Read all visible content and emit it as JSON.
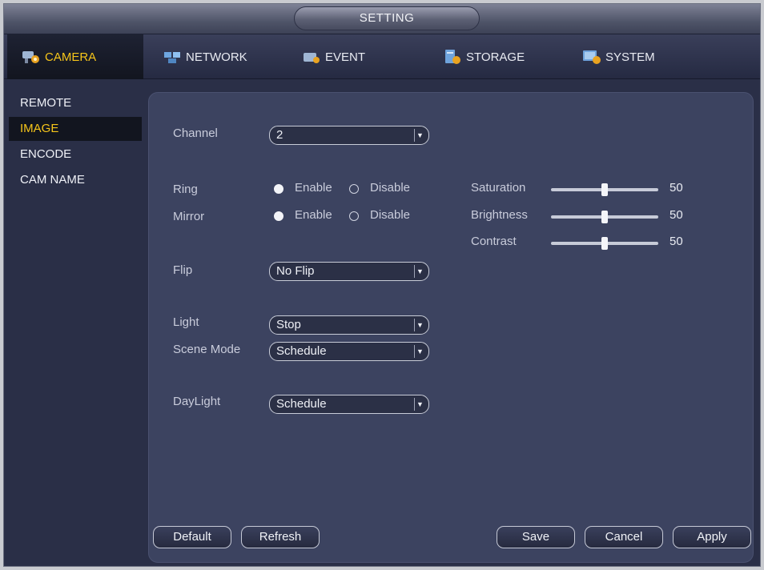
{
  "title": "SETTING",
  "tabs": [
    {
      "label": "CAMERA",
      "icon": "camera-icon",
      "active": true
    },
    {
      "label": "NETWORK",
      "icon": "network-icon"
    },
    {
      "label": "EVENT",
      "icon": "event-icon"
    },
    {
      "label": "STORAGE",
      "icon": "storage-icon"
    },
    {
      "label": "SYSTEM",
      "icon": "system-icon"
    }
  ],
  "sidebar": {
    "items": [
      {
        "label": "REMOTE"
      },
      {
        "label": "IMAGE",
        "active": true
      },
      {
        "label": "ENCODE"
      },
      {
        "label": "CAM NAME"
      }
    ]
  },
  "form": {
    "channel": {
      "label": "Channel",
      "value": "2"
    },
    "ring": {
      "label": "Ring",
      "enable": "Enable",
      "disable": "Disable",
      "selected": "Enable"
    },
    "mirror": {
      "label": "Mirror",
      "enable": "Enable",
      "disable": "Disable",
      "selected": "Enable"
    },
    "flip": {
      "label": "Flip",
      "value": "No Flip"
    },
    "light": {
      "label": "Light",
      "value": "Stop"
    },
    "scene_mode": {
      "label": "Scene Mode",
      "value": "Schedule"
    },
    "daylight": {
      "label": "DayLight",
      "value": "Schedule"
    }
  },
  "adjustments": {
    "saturation": {
      "label": "Saturation",
      "value": "50"
    },
    "brightness": {
      "label": "Brightness",
      "value": "50"
    },
    "contrast": {
      "label": "Contrast",
      "value": "50"
    }
  },
  "buttons": {
    "default": "Default",
    "refresh": "Refresh",
    "save": "Save",
    "cancel": "Cancel",
    "apply": "Apply"
  },
  "colors": {
    "active_text": "#f6c51a",
    "panel_bg": "#3c4360",
    "window_bg": "#2a2f47"
  }
}
